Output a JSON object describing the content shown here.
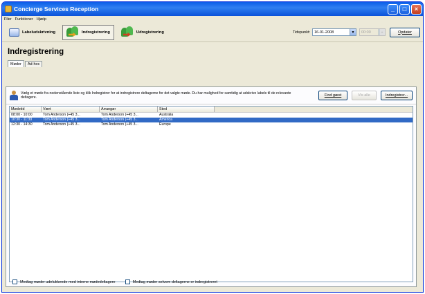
{
  "window": {
    "title": "Concierge Services Reception"
  },
  "menu": {
    "items": [
      "Filer",
      "Funktioner",
      "Hjælp"
    ]
  },
  "toolbar": {
    "buttons": [
      {
        "label": "Labeludskrivning",
        "icon": "label-icon"
      },
      {
        "label": "Indregistrering",
        "icon": "checkin-icon",
        "active": true
      },
      {
        "label": "Udregistrering",
        "icon": "checkout-icon"
      }
    ],
    "tidspunkt_label": "Tidspunkt:",
    "date_value": "16-01-2008",
    "time_value": "00:00",
    "update_label": "Opdater"
  },
  "page": {
    "title": "Indregistrering"
  },
  "tabs": [
    "Møder",
    "Ad-hoc"
  ],
  "info": {
    "text": "Vælg et møde fra nedenstående liste og klik Indregistrer for at indregistrere deltagerne for det valgte møde. Du har mulighed for samtidig at udskrive labels til de relevante deltagere.",
    "find_guest": "Find gæst",
    "vis_alle": "Vis alle",
    "register": "Indregistrer..."
  },
  "list": {
    "columns": [
      "Mødetid",
      "Vært",
      "Arrangør",
      "Sted"
    ],
    "rows": [
      [
        "08:00 - 10:00",
        "Tom Anderson (+45 3...",
        "Tom Anderson (+45 3...",
        "Australia"
      ],
      [
        "10:30 - 11:30",
        "Tom Anderson (+45 3...",
        "Tom Anderson (+45 3...",
        "America"
      ],
      [
        "12:30 - 14:30",
        "Tom Anderson (+45 3...",
        "Tom Anderson (+45 3...",
        "Europe"
      ]
    ],
    "selected_row": 1
  },
  "footer": {
    "checkbox1": "Medtag møder udelukkende med interne mødedeltagere",
    "checkbox2": "Medtag møder selvom deltagerne er indregistreret"
  }
}
